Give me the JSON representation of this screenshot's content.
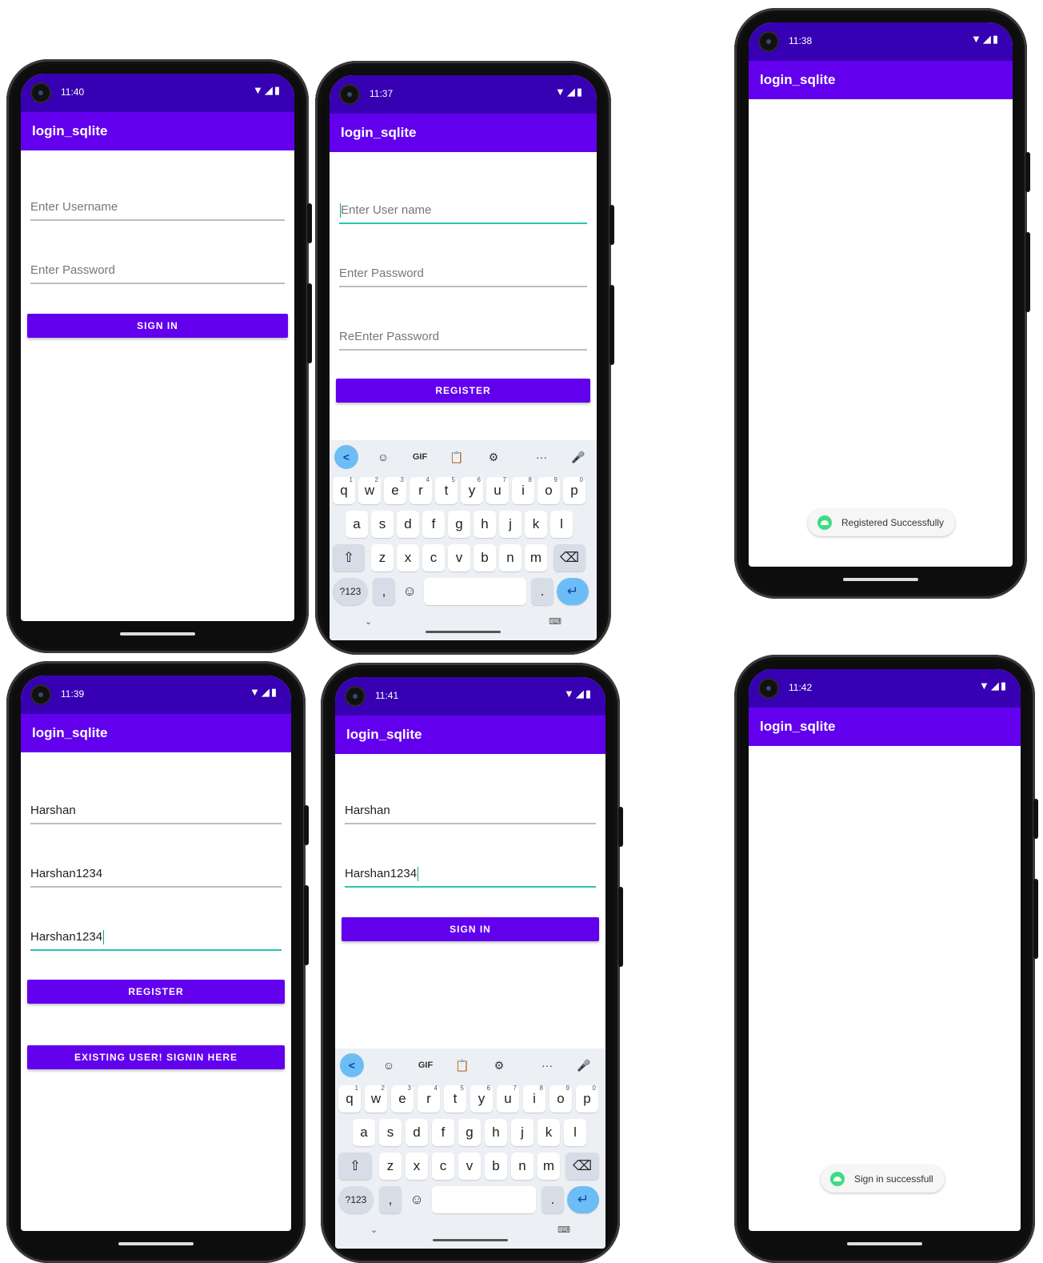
{
  "app_title": "login_sqlite",
  "screens": [
    {
      "time": "11:40",
      "status_icons": "▼◢▮",
      "fields": [
        {
          "text": "Enter Username",
          "placeholder": true
        },
        {
          "text": "Enter Password",
          "placeholder": true
        }
      ],
      "buttons": [
        "SIGN IN"
      ]
    },
    {
      "time": "11:37",
      "status_icons": "▼◢▮",
      "fields": [
        {
          "text": "Enter User name",
          "placeholder": true,
          "focused": true
        },
        {
          "text": "Enter Password",
          "placeholder": true
        },
        {
          "text": "ReEnter Password",
          "placeholder": true
        }
      ],
      "buttons": [
        "REGISTER"
      ]
    },
    {
      "time": "11:38",
      "status_icons": "▼◢▮",
      "toast": "Registered Successfully"
    },
    {
      "time": "11:39",
      "status_icons": "▼◢▮",
      "fields": [
        {
          "text": "Harshan"
        },
        {
          "text": "Harshan1234"
        },
        {
          "text": "Harshan1234",
          "focused": true
        }
      ],
      "buttons": [
        "REGISTER",
        "EXISTING USER! SIGNIN HERE"
      ]
    },
    {
      "time": "11:41",
      "status_icons": "▼◢▮",
      "fields": [
        {
          "text": "Harshan"
        },
        {
          "text": "Harshan1234",
          "focused": true
        }
      ],
      "buttons": [
        "SIGN IN"
      ]
    },
    {
      "time": "11:42",
      "status_icons": "▼◢▮",
      "toast": "Sign in successfull"
    }
  ],
  "keyboard": {
    "tools": [
      "<",
      "☺",
      "GIF",
      "📋",
      "⚙",
      "···",
      "🎤"
    ],
    "row1": [
      [
        "q",
        "1"
      ],
      [
        "w",
        "2"
      ],
      [
        "e",
        "3"
      ],
      [
        "r",
        "4"
      ],
      [
        "t",
        "5"
      ],
      [
        "y",
        "6"
      ],
      [
        "u",
        "7"
      ],
      [
        "i",
        "8"
      ],
      [
        "o",
        "9"
      ],
      [
        "p",
        "0"
      ]
    ],
    "row2": [
      "a",
      "s",
      "d",
      "f",
      "g",
      "h",
      "j",
      "k",
      "l"
    ],
    "row3": [
      "z",
      "x",
      "c",
      "v",
      "b",
      "n",
      "m"
    ],
    "shift": "⇧",
    "backspace": "⌫",
    "symbols": "?123",
    "comma": ",",
    "emoji": "☺",
    "period": ".",
    "enter": "↵",
    "hide": "⌄",
    "switch": "⌨"
  },
  "colors": {
    "status_bar": "#3700b3",
    "app_bar": "#6200ee",
    "accent": "#26c6b0",
    "toast_icon": "#3ddc84"
  }
}
